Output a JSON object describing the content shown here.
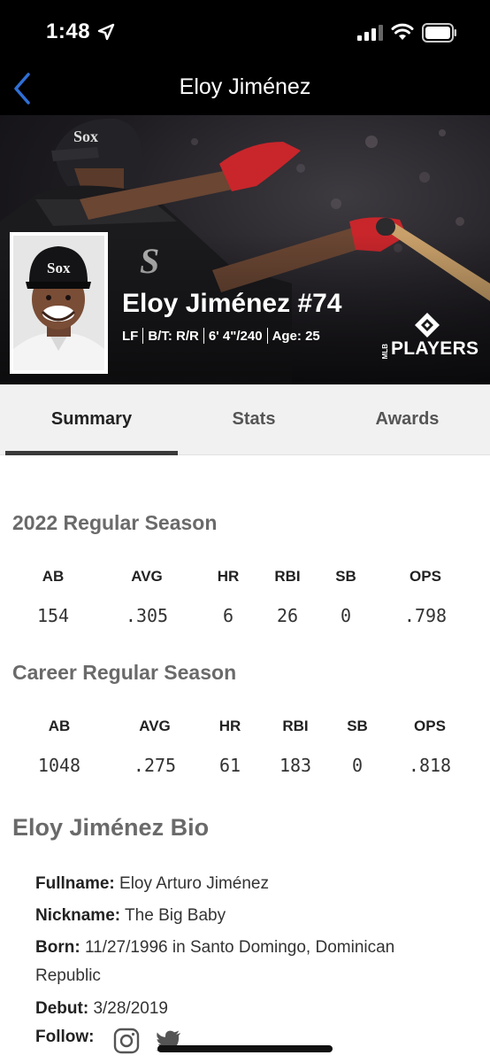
{
  "status_bar": {
    "time": "1:48",
    "icons": [
      "location-arrow-icon",
      "cellular-signal-icon",
      "wifi-icon",
      "battery-icon"
    ]
  },
  "nav": {
    "title": "Eloy Jiménez",
    "back_icon": "chevron-left-icon"
  },
  "hero": {
    "name_number": "Eloy Jiménez #74",
    "meta": [
      "LF",
      "B/T: R/R",
      "6' 4\"/240",
      "Age: 25"
    ],
    "logo_text": "PLAYERS",
    "logo_small": "MLB"
  },
  "tabs": [
    {
      "label": "Summary",
      "active": true
    },
    {
      "label": "Stats",
      "active": false
    },
    {
      "label": "Awards",
      "active": false
    }
  ],
  "season": {
    "title": "2022 Regular Season",
    "headers": [
      "AB",
      "AVG",
      "HR",
      "RBI",
      "SB",
      "OPS"
    ],
    "values": [
      "154",
      ".305",
      "6",
      "26",
      "0",
      ".798"
    ]
  },
  "career": {
    "title": "Career Regular Season",
    "headers": [
      "AB",
      "AVG",
      "HR",
      "RBI",
      "SB",
      "OPS"
    ],
    "values": [
      "1048",
      ".275",
      "61",
      "183",
      "0",
      ".818"
    ]
  },
  "bio": {
    "title": "Eloy Jiménez Bio",
    "fullname_label": "Fullname:",
    "fullname": "Eloy Arturo Jiménez",
    "nickname_label": "Nickname:",
    "nickname": "The Big Baby",
    "born_label": "Born:",
    "born": "11/27/1996 in Santo Domingo, Dominican Republic",
    "debut_label": "Debut:",
    "debut": "3/28/2019",
    "follow_label": "Follow:"
  },
  "colors": {
    "accent_back": "#2f6fd6",
    "background_dark": "#000000",
    "tab_bg": "#f1f1f1"
  }
}
